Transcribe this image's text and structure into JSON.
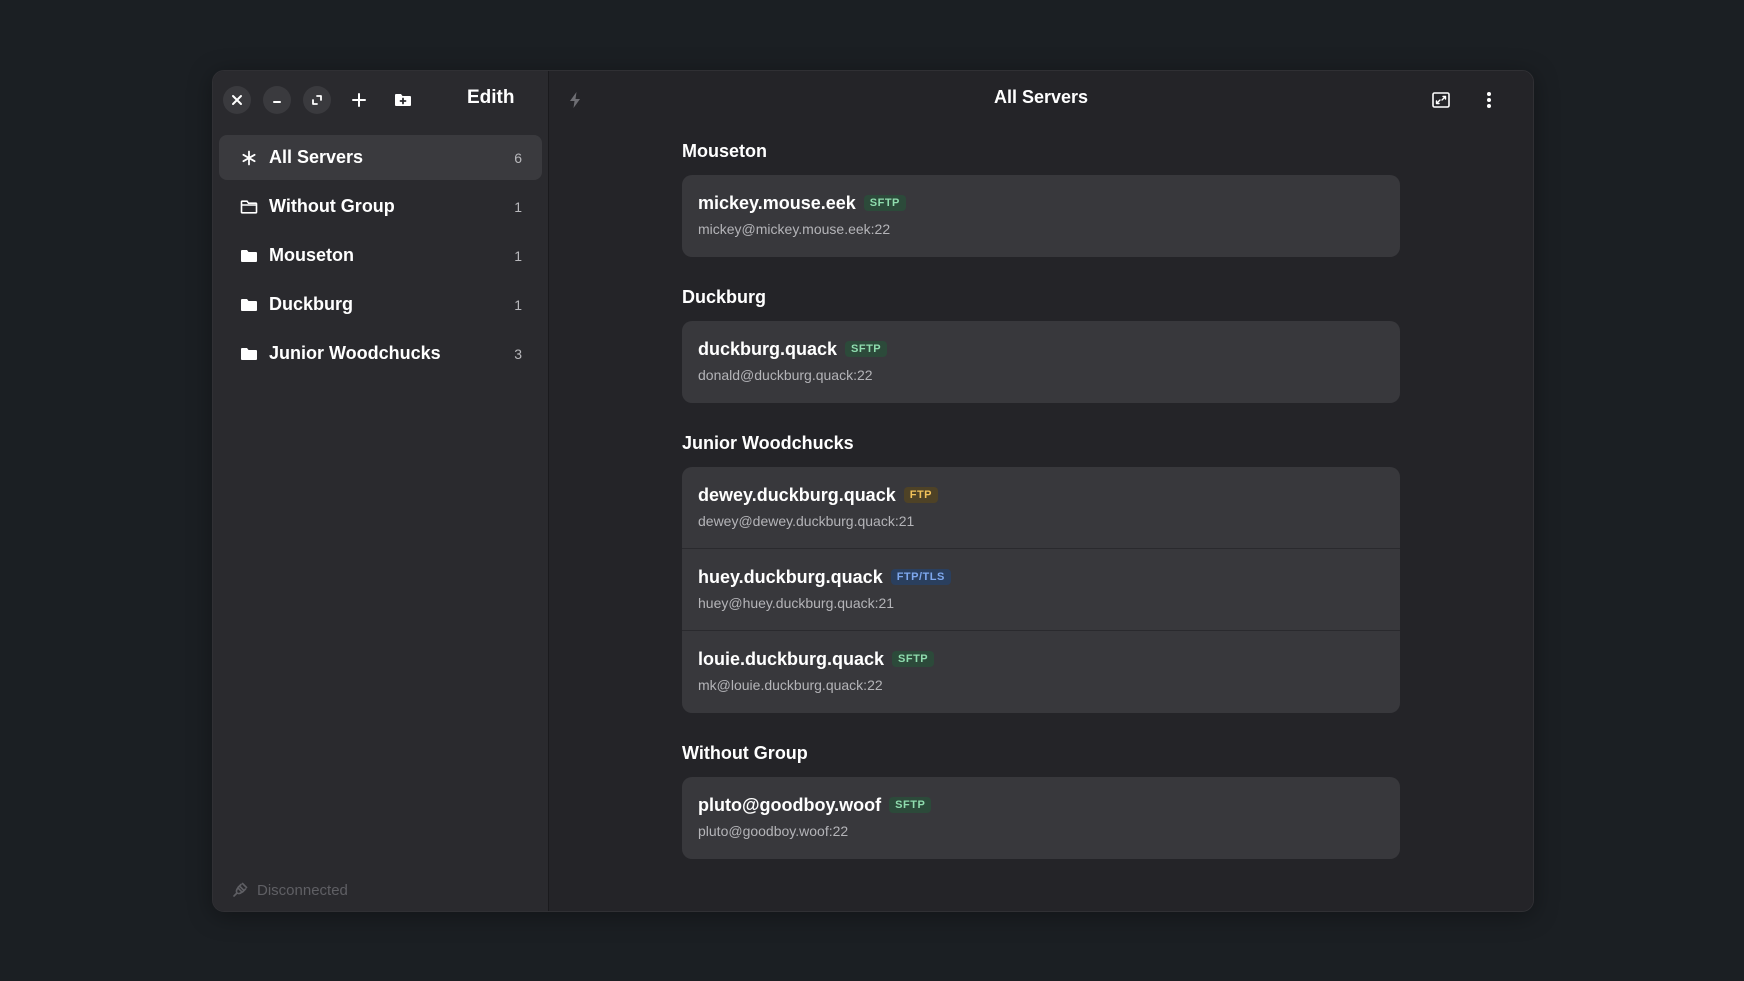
{
  "app": {
    "title": "Edith"
  },
  "header": {
    "title": "All Servers"
  },
  "sidebar": {
    "items": [
      {
        "label": "All Servers",
        "count": "6",
        "icon": "asterisk-icon",
        "selected": true
      },
      {
        "label": "Without Group",
        "count": "1",
        "icon": "folder-outline-icon",
        "selected": false
      },
      {
        "label": "Mouseton",
        "count": "1",
        "icon": "folder-icon",
        "selected": false
      },
      {
        "label": "Duckburg",
        "count": "1",
        "icon": "folder-icon",
        "selected": false
      },
      {
        "label": "Junior Woodchucks",
        "count": "3",
        "icon": "folder-icon",
        "selected": false
      }
    ],
    "status": "Disconnected"
  },
  "groups": [
    {
      "title": "Mouseton",
      "servers": [
        {
          "name": "mickey.mouse.eek",
          "protocol": "SFTP",
          "address": "mickey@mickey.mouse.eek:22"
        }
      ]
    },
    {
      "title": "Duckburg",
      "servers": [
        {
          "name": "duckburg.quack",
          "protocol": "SFTP",
          "address": "donald@duckburg.quack:22"
        }
      ]
    },
    {
      "title": "Junior Woodchucks",
      "servers": [
        {
          "name": "dewey.duckburg.quack",
          "protocol": "FTP",
          "address": "dewey@dewey.duckburg.quack:21"
        },
        {
          "name": "huey.duckburg.quack",
          "protocol": "FTP/TLS",
          "address": "huey@huey.duckburg.quack:21"
        },
        {
          "name": "louie.duckburg.quack",
          "protocol": "SFTP",
          "address": "mk@louie.duckburg.quack:22"
        }
      ]
    },
    {
      "title": "Without Group",
      "servers": [
        {
          "name": "pluto@goodboy.woof",
          "protocol": "SFTP",
          "address": "pluto@goodboy.woof:22"
        }
      ]
    }
  ],
  "colors": {
    "background": "#1b1f23",
    "sidebar": "#2a2a2e",
    "content": "#242428",
    "card": "#38383c",
    "sftp_badge": "#8fdcae",
    "ftp_badge": "#f1c25a",
    "ftptls_badge": "#7ea8ee"
  }
}
